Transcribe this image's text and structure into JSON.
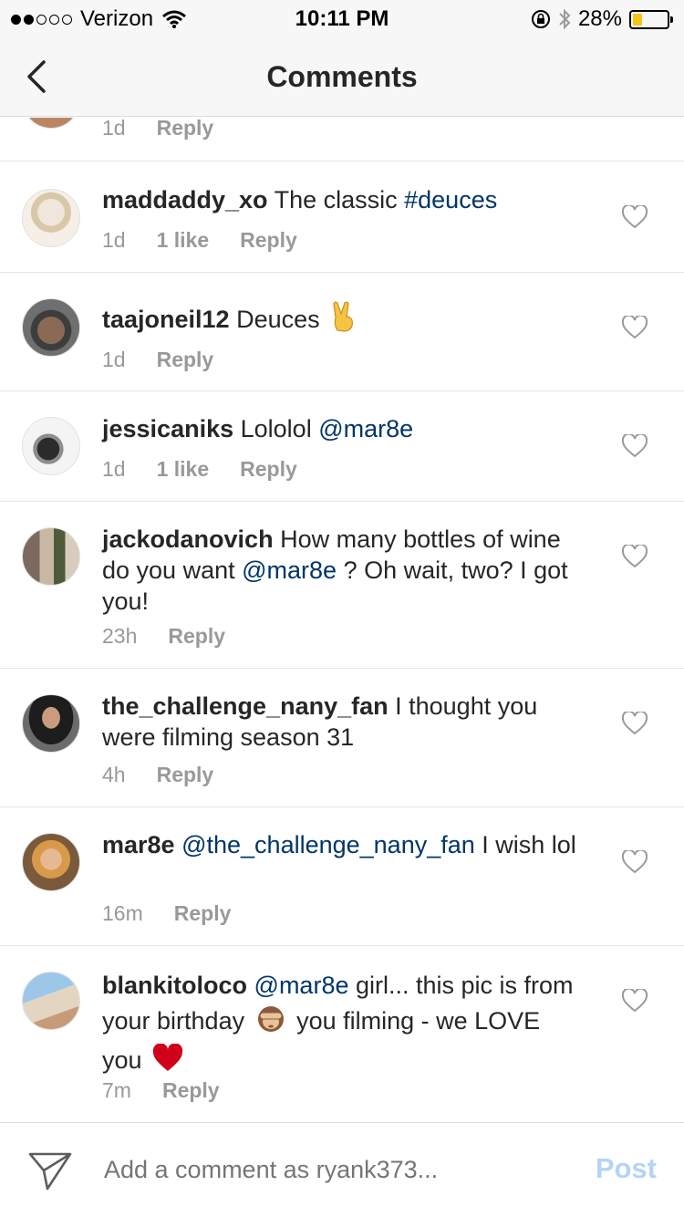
{
  "status_bar": {
    "carrier": "Verizon",
    "time": "10:11 PM",
    "battery_percent": "28%",
    "battery_level": 0.28,
    "signal_bars_filled": 2,
    "signal_bars_total": 5,
    "icons": [
      "wifi-icon",
      "rotation-lock-icon",
      "bluetooth-icon",
      "battery-icon"
    ]
  },
  "nav": {
    "title": "Comments",
    "back_icon": "chevron-left-icon"
  },
  "comments": [
    {
      "meta_time": "1d",
      "reply": "Reply"
    },
    {
      "username": "maddaddy_xo",
      "text_parts": [
        {
          "t": " The classic "
        },
        {
          "t": "#deuces",
          "link": true
        }
      ],
      "time": "1d",
      "likes": "1 like",
      "reply": "Reply"
    },
    {
      "username": "taajoneil12",
      "text_parts": [
        {
          "t": " Deuces "
        }
      ],
      "emoji": "victory-hand-emoji",
      "time": "1d",
      "reply": "Reply"
    },
    {
      "username": "jessicaniks",
      "text_parts": [
        {
          "t": " Lololol "
        },
        {
          "t": "@mar8e",
          "link": true
        }
      ],
      "time": "1d",
      "likes": "1 like",
      "reply": "Reply"
    },
    {
      "username": "jackodanovich",
      "text_parts": [
        {
          "t": " How many bottles of wine do you want "
        },
        {
          "t": "@mar8e",
          "link": true
        },
        {
          "t": " ? Oh wait, two? I got you!"
        }
      ],
      "time": "23h",
      "reply": "Reply"
    },
    {
      "username": "the_challenge_nany_fan",
      "text_parts": [
        {
          "t": " I thought you were filming season 31"
        }
      ],
      "time": "4h",
      "reply": "Reply"
    },
    {
      "username": "mar8e",
      "text_parts": [
        {
          "t": " "
        },
        {
          "t": "@the_challenge_nany_fan",
          "link": true
        },
        {
          "t": " I wish lol"
        }
      ],
      "time": "16m",
      "reply": "Reply"
    },
    {
      "username": "blankitoloco",
      "text_parts": [
        {
          "t": " "
        },
        {
          "t": "@mar8e",
          "link": true
        },
        {
          "t": " girl... this pic is from your birthday "
        },
        {
          "emoji": "see-no-evil-monkey-emoji"
        },
        {
          "t": "  you filming - we LOVE you "
        },
        {
          "emoji": "red-heart-emoji"
        }
      ],
      "time": "7m",
      "reply": "Reply"
    }
  ],
  "composer": {
    "placeholder": "Add a comment as ryank373...",
    "post_label": "Post",
    "send_icon": "paper-plane-icon"
  },
  "colors": {
    "mention": "#003569",
    "meta": "#999999",
    "post_disabled": "#b3d4f5",
    "battery_fill": "#f5c518"
  }
}
